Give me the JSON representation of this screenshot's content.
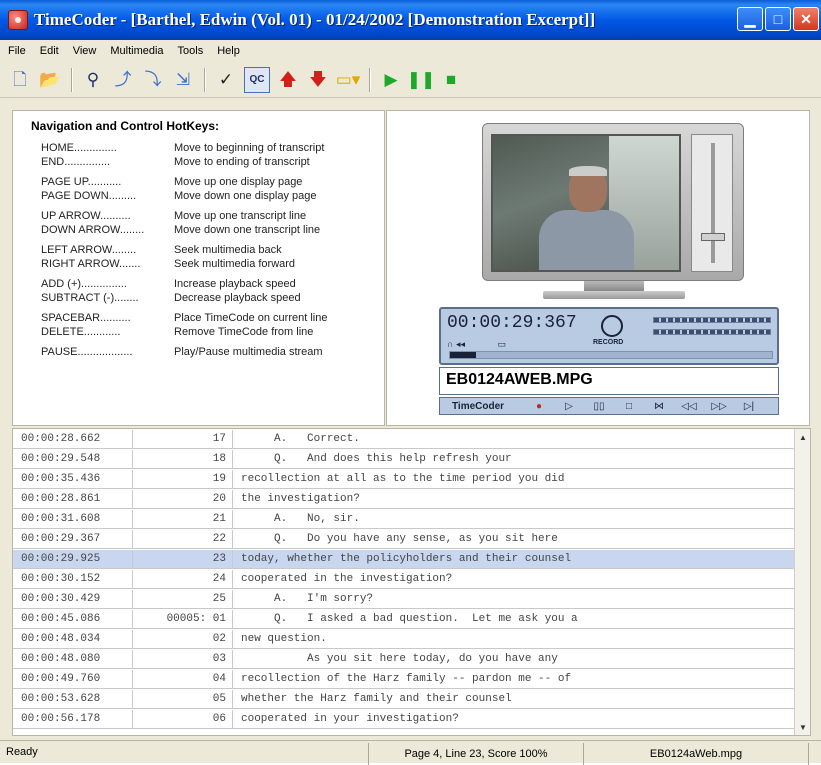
{
  "window": {
    "title": "TimeCoder - [Barthel, Edwin (Vol. 01) - 01/24/2002 [Demonstration Excerpt]]",
    "controls": [
      "minimize",
      "maximize",
      "close"
    ]
  },
  "menu": [
    "File",
    "Edit",
    "View",
    "Multimedia",
    "Tools",
    "Help"
  ],
  "toolbar": {
    "icons": [
      "new-document-icon",
      "open-folder-icon",
      "find-icon",
      "link-icon",
      "link-down-icon",
      "link-search-icon",
      "checkmark-icon",
      "qc-icon",
      "up-arrow-icon",
      "down-arrow-icon",
      "folder-dropdown-icon",
      "play-icon",
      "pause-icon",
      "stop-icon"
    ],
    "qc_label": "QC"
  },
  "hotkeys": {
    "title": "Navigation and Control HotKeys:",
    "items": [
      {
        "key": "HOME..............",
        "desc": "Move to beginning of transcript"
      },
      {
        "key": "END...............",
        "desc": "Move to ending of transcript"
      },
      {
        "key": "PAGE UP...........",
        "desc": "Move up one display page"
      },
      {
        "key": "PAGE DOWN.........",
        "desc": "Move down one display page"
      },
      {
        "key": "UP ARROW..........",
        "desc": "Move up one transcript line"
      },
      {
        "key": "DOWN ARROW........",
        "desc": "Move down one transcript line"
      },
      {
        "key": "LEFT ARROW........",
        "desc": "Seek multimedia back"
      },
      {
        "key": "RIGHT ARROW.......",
        "desc": "Seek multimedia forward"
      },
      {
        "key": "ADD (+)...............",
        "desc": "Increase playback speed"
      },
      {
        "key": "SUBTRACT (-)........",
        "desc": "Decrease playback speed"
      },
      {
        "key": "SPACEBAR..........",
        "desc": "Place TimeCode on current line"
      },
      {
        "key": "DELETE............",
        "desc": "Remove TimeCode from line"
      },
      {
        "key": "PAUSE..................",
        "desc": "Play/Pause multimedia stream"
      }
    ]
  },
  "player": {
    "time": "00:00:29:367",
    "record_label": "RECORD",
    "filename": "EB0124AWEB.MPG",
    "brand": "TimeCoder",
    "transport_buttons": [
      "●",
      "▷",
      "▯▯",
      "□",
      "⋈",
      "◁◁",
      "▷▷",
      "▷|"
    ],
    "level_fraction": 0.08
  },
  "transcript": {
    "selected_index": 6,
    "rows": [
      {
        "time": "00:00:28.662",
        "line": "17",
        "text": "     A.   Correct."
      },
      {
        "time": "00:00:29.548",
        "line": "18",
        "text": "     Q.   And does this help refresh your"
      },
      {
        "time": "00:00:35.436",
        "line": "19",
        "text": "recollection at all as to the time period you did"
      },
      {
        "time": "00:00:28.861",
        "line": "20",
        "text": "the investigation?"
      },
      {
        "time": "00:00:31.608",
        "line": "21",
        "text": "     A.   No, sir."
      },
      {
        "time": "00:00:29.367",
        "line": "22",
        "text": "     Q.   Do you have any sense, as you sit here"
      },
      {
        "time": "00:00:29.925",
        "line": "23",
        "text": "today, whether the policyholders and their counsel"
      },
      {
        "time": "00:00:30.152",
        "line": "24",
        "text": "cooperated in the investigation?"
      },
      {
        "time": "00:00:30.429",
        "line": "25",
        "text": "     A.   I'm sorry?"
      },
      {
        "time": "00:00:45.086",
        "line": "00005: 01",
        "text": "     Q.   I asked a bad question.  Let me ask you a"
      },
      {
        "time": "00:00:48.034",
        "line": "02",
        "text": "new question."
      },
      {
        "time": "00:00:48.080",
        "line": "03",
        "text": "          As you sit here today, do you have any"
      },
      {
        "time": "00:00:49.760",
        "line": "04",
        "text": "recollection of the Harz family -- pardon me -- of"
      },
      {
        "time": "00:00:53.628",
        "line": "05",
        "text": "whether the Harz family and their counsel"
      },
      {
        "time": "00:00:56.178",
        "line": "06",
        "text": "cooperated in your investigation?"
      }
    ]
  },
  "status": {
    "ready": "Ready",
    "position": "Page 4, Line 23, Score 100%",
    "file": "EB0124aWeb.mpg"
  }
}
